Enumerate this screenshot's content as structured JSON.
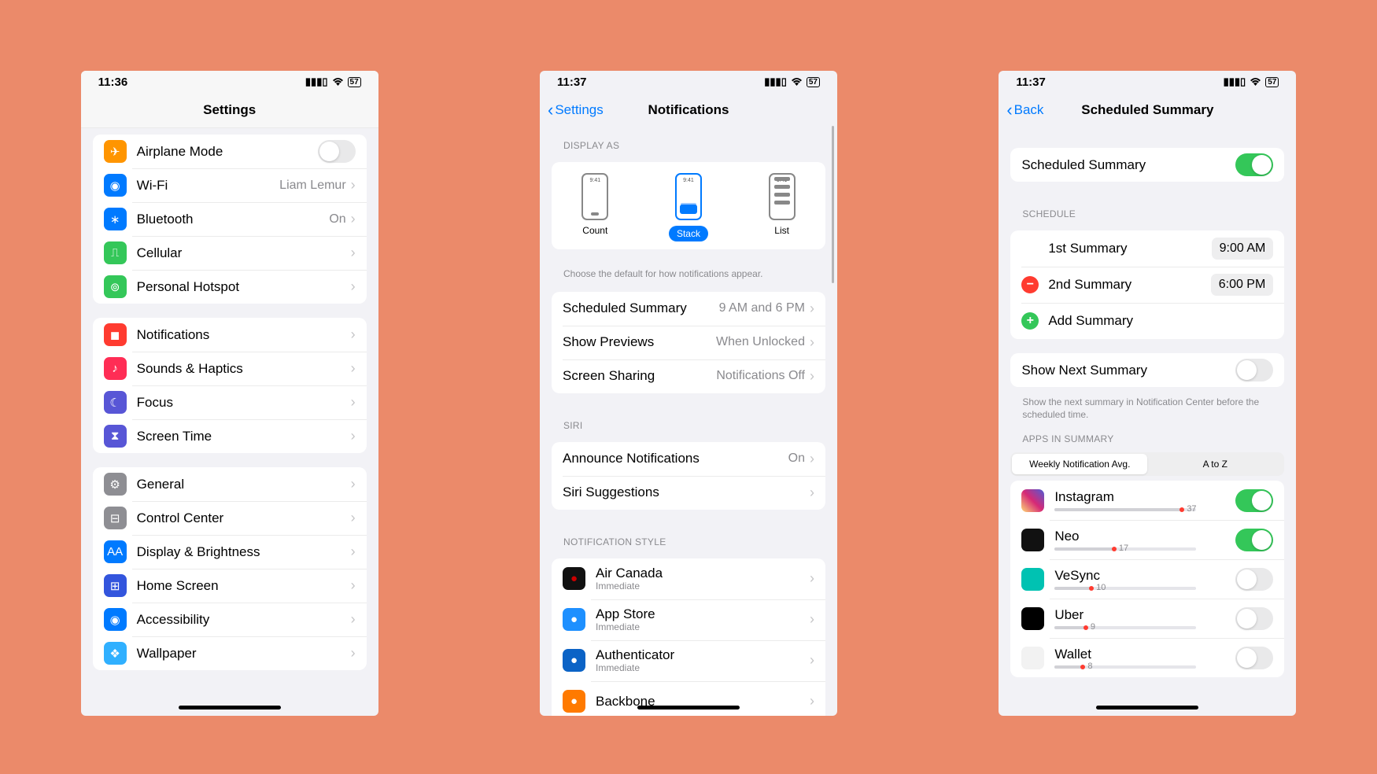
{
  "phone1": {
    "time": "11:36",
    "title": "Settings",
    "group1": [
      {
        "icon": "airplane",
        "bg": "#ff9500",
        "label": "Airplane Mode",
        "type": "toggle",
        "on": false
      },
      {
        "icon": "wifi",
        "bg": "#007aff",
        "label": "Wi-Fi",
        "val": "Liam Lemur",
        "type": "chev"
      },
      {
        "icon": "bluetooth",
        "bg": "#007aff",
        "label": "Bluetooth",
        "val": "On",
        "type": "chev"
      },
      {
        "icon": "cellular",
        "bg": "#34c759",
        "label": "Cellular",
        "type": "chev"
      },
      {
        "icon": "hotspot",
        "bg": "#34c759",
        "label": "Personal Hotspot",
        "type": "chev"
      }
    ],
    "group2": [
      {
        "icon": "notifications",
        "bg": "#ff3b30",
        "label": "Notifications",
        "type": "chev"
      },
      {
        "icon": "sounds",
        "bg": "#ff2d55",
        "label": "Sounds & Haptics",
        "type": "chev"
      },
      {
        "icon": "focus",
        "bg": "#5856d6",
        "label": "Focus",
        "type": "chev"
      },
      {
        "icon": "screentime",
        "bg": "#5856d6",
        "label": "Screen Time",
        "type": "chev"
      }
    ],
    "group3": [
      {
        "icon": "general",
        "bg": "#8e8e93",
        "label": "General",
        "type": "chev"
      },
      {
        "icon": "control",
        "bg": "#8e8e93",
        "label": "Control Center",
        "type": "chev"
      },
      {
        "icon": "display",
        "bg": "#007aff",
        "label": "Display & Brightness",
        "type": "chev"
      },
      {
        "icon": "home",
        "bg": "#3355dd",
        "label": "Home Screen",
        "type": "chev"
      },
      {
        "icon": "accessibility",
        "bg": "#007aff",
        "label": "Accessibility",
        "type": "chev"
      },
      {
        "icon": "wallpaper",
        "bg": "#30b0ff",
        "label": "Wallpaper",
        "type": "chev"
      }
    ]
  },
  "phone2": {
    "time": "11:37",
    "back": "Settings",
    "title": "Notifications",
    "display_as_header": "Display As",
    "display_as": [
      {
        "label": "Count",
        "selected": false,
        "kind": "count",
        "time": "9:41"
      },
      {
        "label": "Stack",
        "selected": true,
        "kind": "stack",
        "time": "9:41"
      },
      {
        "label": "List",
        "selected": false,
        "kind": "list",
        "time": "9:41"
      }
    ],
    "display_footer": "Choose the default for how notifications appear.",
    "group1": [
      {
        "label": "Scheduled Summary",
        "val": "9 AM and 6 PM"
      },
      {
        "label": "Show Previews",
        "val": "When Unlocked"
      },
      {
        "label": "Screen Sharing",
        "val": "Notifications Off"
      }
    ],
    "siri_header": "Siri",
    "group2": [
      {
        "label": "Announce Notifications",
        "val": "On"
      },
      {
        "label": "Siri Suggestions",
        "val": ""
      }
    ],
    "style_header": "Notification Style",
    "apps": [
      {
        "label": "Air Canada",
        "sub": "Immediate",
        "bg": "#111",
        "fg": "#c00"
      },
      {
        "label": "App Store",
        "sub": "Immediate",
        "bg": "#1e90ff",
        "fg": "#fff"
      },
      {
        "label": "Authenticator",
        "sub": "Immediate",
        "bg": "#0b63c6",
        "fg": "#fff"
      },
      {
        "label": "Backbone",
        "sub": "",
        "bg": "#ff7a00",
        "fg": "#fff"
      }
    ]
  },
  "phone3": {
    "time": "11:37",
    "back": "Back",
    "title": "Scheduled Summary",
    "row_enable": {
      "label": "Scheduled Summary",
      "on": true
    },
    "schedule_header": "Schedule",
    "schedule": [
      {
        "label": "1st Summary",
        "time": "9:00 AM",
        "kind": "plain"
      },
      {
        "label": "2nd Summary",
        "time": "6:00 PM",
        "kind": "delete"
      },
      {
        "label": "Add Summary",
        "kind": "add"
      }
    ],
    "show_next": {
      "label": "Show Next Summary",
      "on": false
    },
    "show_next_footer": "Show the next summary in Notification Center before the scheduled time.",
    "apps_header": "Apps in Summary",
    "segments": [
      "Weekly Notification Avg.",
      "A to Z"
    ],
    "segment_selected": 0,
    "apps": [
      {
        "label": "Instagram",
        "count": 37,
        "on": true,
        "bg": "linear-gradient(45deg,#feda75,#d62976,#4f5bd5)",
        "fill": 90
      },
      {
        "label": "Neo",
        "count": 17,
        "on": true,
        "bg": "#111",
        "fill": 42
      },
      {
        "label": "VeSync",
        "count": 10,
        "on": false,
        "bg": "#00c2b2",
        "fill": 26
      },
      {
        "label": "Uber",
        "count": 9,
        "on": false,
        "bg": "#000",
        "fill": 22
      },
      {
        "label": "Wallet",
        "count": 8,
        "on": false,
        "bg": "#f2f2f2",
        "fill": 20
      }
    ]
  }
}
